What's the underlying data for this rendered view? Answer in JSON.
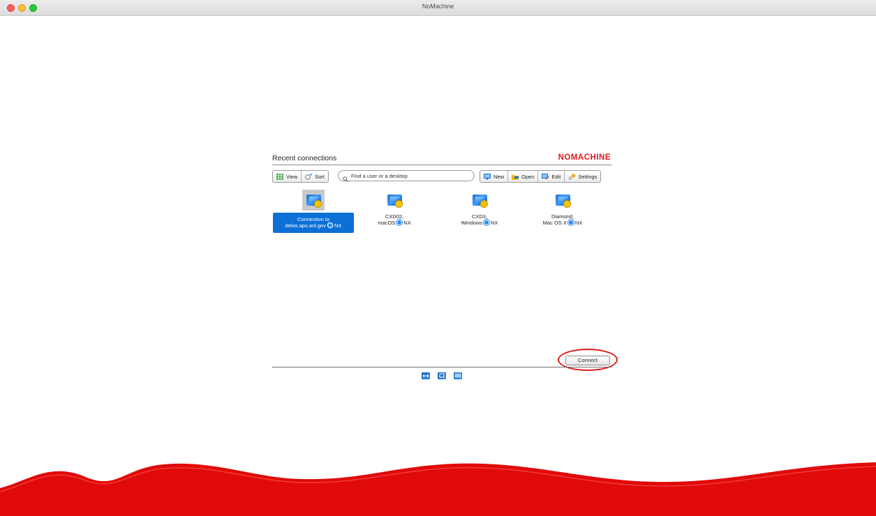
{
  "window": {
    "title": "NoMachine"
  },
  "panel": {
    "heading": "Recent connections",
    "brand": "NOMACHINE"
  },
  "toolbar": {
    "view_label": "View",
    "sort_label": "Sort",
    "new_label": "New",
    "open_label": "Open",
    "edit_label": "Edit",
    "settings_label": "Settings"
  },
  "search": {
    "placeholder": "Find a user or a desktop"
  },
  "connections": [
    {
      "line1": "Connection to",
      "line2a": "delos.aps.anl.gov",
      "protocol": "NX",
      "selected": true
    },
    {
      "line1": "CXD02,",
      "line2a": "macOS",
      "protocol": "NX",
      "selected": false
    },
    {
      "line1": "CXD3,",
      "line2a": "Windows",
      "protocol": "NX",
      "selected": false
    },
    {
      "line1": "Diamond,",
      "line2a": "Mac OS X",
      "protocol": "NX",
      "selected": false
    }
  ],
  "actions": {
    "connect_label": "Connect"
  },
  "colors": {
    "brand_red": "#e3171c",
    "selection_blue": "#0b6fd6",
    "highlight_red": "#e01b1b"
  },
  "icons": {
    "view": "grid-icon",
    "sort": "sort-icon",
    "search": "search-icon",
    "new": "new-connection-icon",
    "open": "folder-open-icon",
    "edit": "edit-icon",
    "settings": "gear-icon",
    "connection": "monitor-icon",
    "footer": [
      "fullscreen-icon",
      "share-icon",
      "display-icon"
    ]
  }
}
